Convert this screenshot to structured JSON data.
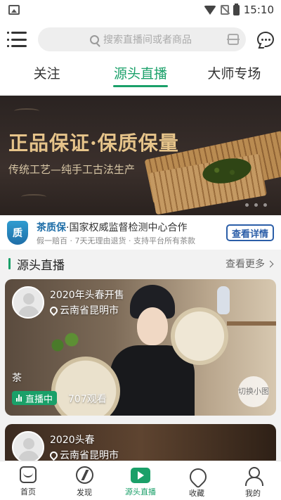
{
  "status_bar": {
    "time": "15:10",
    "icons": [
      "image-icon",
      "wifi-icon",
      "no-sim-icon",
      "battery-icon"
    ]
  },
  "header": {
    "search_placeholder": "搜索直播间或者商品",
    "icons": [
      "menu-icon",
      "search-icon",
      "scan-icon",
      "chat-icon"
    ]
  },
  "tabs": [
    {
      "label": "关注",
      "active": false
    },
    {
      "label": "源头直播",
      "active": true
    },
    {
      "label": "大师专场",
      "active": false
    }
  ],
  "banner": {
    "title": "正品保证·保质保量",
    "subtitle": "传统工艺—纯手工古法生产"
  },
  "quality_bar": {
    "badge": "质",
    "brand": "茶质保",
    "headline": "·国家权威监督检测中心合作",
    "subline": "假一赔百 · 7天无理由退货 · 支持平台所有茶款",
    "button": "查看详情"
  },
  "section": {
    "title": "源头直播",
    "more": "查看更多"
  },
  "live_cards": [
    {
      "title": "2020年头春开售",
      "location": "云南省昆明市",
      "tag": "茶",
      "status": "直播中",
      "viewers": "707观看",
      "switch_label": "切换小图"
    },
    {
      "title": "2020头春",
      "location": "云南省昆明市"
    }
  ],
  "bottom_nav": [
    {
      "label": "首页",
      "icon": "home-icon",
      "active": false
    },
    {
      "label": "发现",
      "icon": "discover-icon",
      "active": false
    },
    {
      "label": "源头直播",
      "icon": "live-icon",
      "active": true
    },
    {
      "label": "收藏",
      "icon": "favorite-icon",
      "active": false
    },
    {
      "label": "我的",
      "icon": "profile-icon",
      "active": false
    }
  ],
  "colors": {
    "accent": "#1aa069",
    "brand_blue": "#1f6ea8",
    "button_blue": "#2b5ea8"
  }
}
